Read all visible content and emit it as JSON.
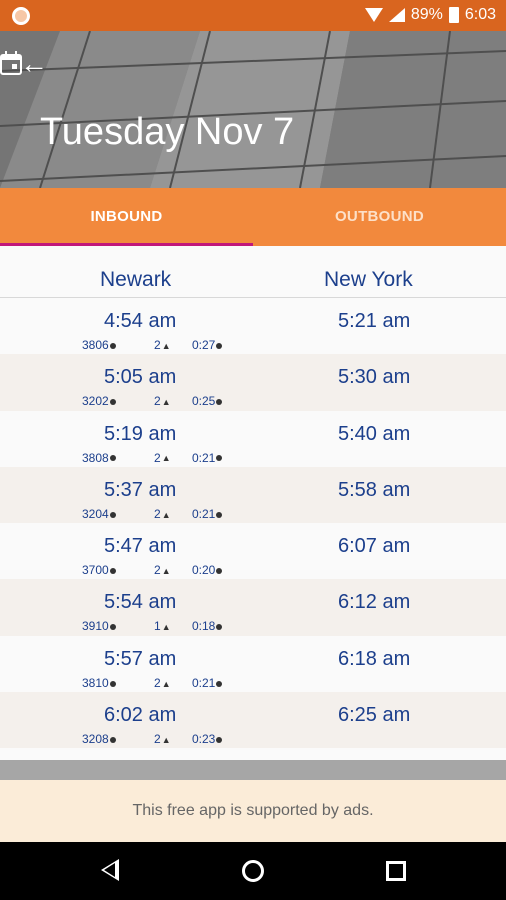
{
  "status_bar": {
    "battery": "89%",
    "time": "6:03"
  },
  "header": {
    "title": "Tuesday Nov 7"
  },
  "tabs": [
    {
      "label": "INBOUND"
    },
    {
      "label": "OUTBOUND"
    }
  ],
  "columns": {
    "origin": "Newark",
    "destination": "New York"
  },
  "trips": [
    {
      "depart": "4:54 am",
      "arrive": "5:21 am",
      "train": "3806",
      "transfers": "2",
      "duration": "0:27"
    },
    {
      "depart": "5:05 am",
      "arrive": "5:30 am",
      "train": "3202",
      "transfers": "2",
      "duration": "0:25"
    },
    {
      "depart": "5:19 am",
      "arrive": "5:40 am",
      "train": "3808",
      "transfers": "2",
      "duration": "0:21"
    },
    {
      "depart": "5:37 am",
      "arrive": "5:58 am",
      "train": "3204",
      "transfers": "2",
      "duration": "0:21"
    },
    {
      "depart": "5:47 am",
      "arrive": "6:07 am",
      "train": "3700",
      "transfers": "2",
      "duration": "0:20"
    },
    {
      "depart": "5:54 am",
      "arrive": "6:12 am",
      "train": "3910",
      "transfers": "1",
      "duration": "0:18"
    },
    {
      "depart": "5:57 am",
      "arrive": "6:18 am",
      "train": "3810",
      "transfers": "2",
      "duration": "0:21"
    },
    {
      "depart": "6:02 am",
      "arrive": "6:25 am",
      "train": "3208",
      "transfers": "2",
      "duration": "0:23"
    }
  ],
  "ad": {
    "text": "This free app is supported by ads."
  },
  "colors": {
    "status_bar": "#d9651f",
    "tab_bar": "#f2893d",
    "tab_indicator": "#c0177a",
    "text_primary": "#1c3f8c"
  }
}
